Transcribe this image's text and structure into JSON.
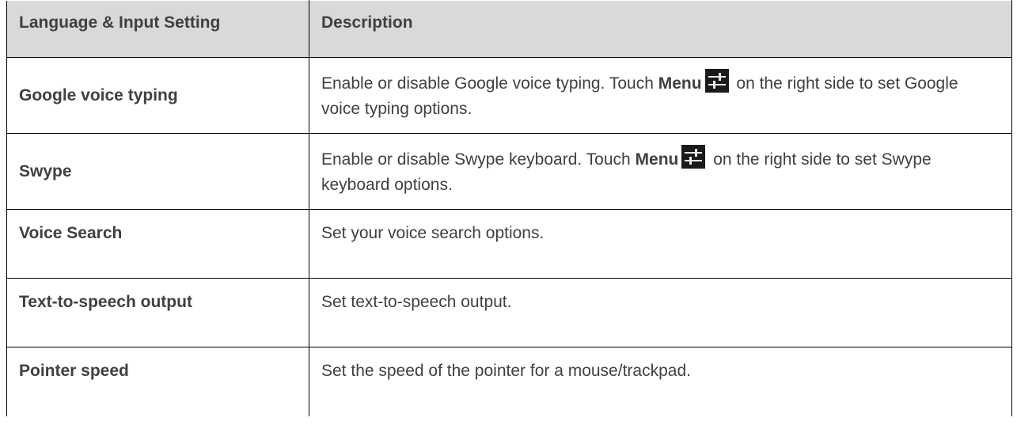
{
  "table": {
    "headers": [
      "Language & Input Setting",
      "Description"
    ],
    "rows": [
      {
        "setting": "Google voice typing",
        "desc_before": "Enable or disable Google voice typing. Touch ",
        "menu_label": "Menu",
        "menu_icon": "settings-sliders-icon",
        "desc_after": " on the right side to set Google voice typing options."
      },
      {
        "setting": "Swype",
        "desc_before": "Enable or disable Swype keyboard. Touch ",
        "menu_label": "Menu",
        "menu_icon": "settings-sliders-icon",
        "desc_after": " on the right side to set Swype keyboard options."
      },
      {
        "setting": "Voice Search",
        "description": "Set your voice search options."
      },
      {
        "setting": "Text-to-speech output",
        "description": "Set text-to-speech output."
      },
      {
        "setting": "Pointer speed",
        "description": "Set the speed of the pointer for a mouse/trackpad."
      }
    ]
  }
}
